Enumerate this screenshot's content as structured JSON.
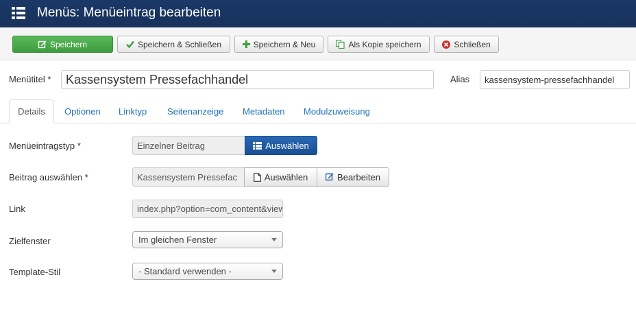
{
  "header": {
    "title": "Menüs: Menüeintrag bearbeiten"
  },
  "toolbar": {
    "save": "Speichern",
    "save_close": "Speichern & Schließen",
    "save_new": "Speichern & Neu",
    "save_copy": "Als Kopie speichern",
    "close": "Schließen"
  },
  "form": {
    "title_label": "Menütitel *",
    "title_value": "Kassensystem Pressefachhandel",
    "alias_label": "Alias",
    "alias_value": "kassensystem-pressefachhandel"
  },
  "tabs": [
    {
      "label": "Details"
    },
    {
      "label": "Optionen"
    },
    {
      "label": "Linktyp"
    },
    {
      "label": "Seitenanzeige"
    },
    {
      "label": "Metadaten"
    },
    {
      "label": "Modulzuweisung"
    }
  ],
  "fields": {
    "menu_type": {
      "label": "Menüeintragstyp *",
      "value": "Einzelner Beitrag",
      "button": "Auswählen"
    },
    "article": {
      "label": "Beitrag auswählen *",
      "value": "Kassensystem Pressefac",
      "select_button": "Auswählen",
      "edit_button": "Bearbeiten"
    },
    "link": {
      "label": "Link",
      "value": "index.php?option=com_content&view"
    },
    "target": {
      "label": "Zielfenster",
      "value": "Im gleichen Fenster"
    },
    "template": {
      "label": "Template-Stil",
      "value": "- Standard verwenden -"
    }
  },
  "colors": {
    "header_bg": "#1a3867",
    "primary_green": "#4cae4c",
    "select_blue": "#1f5aa3",
    "link_blue": "#1f73b8"
  }
}
